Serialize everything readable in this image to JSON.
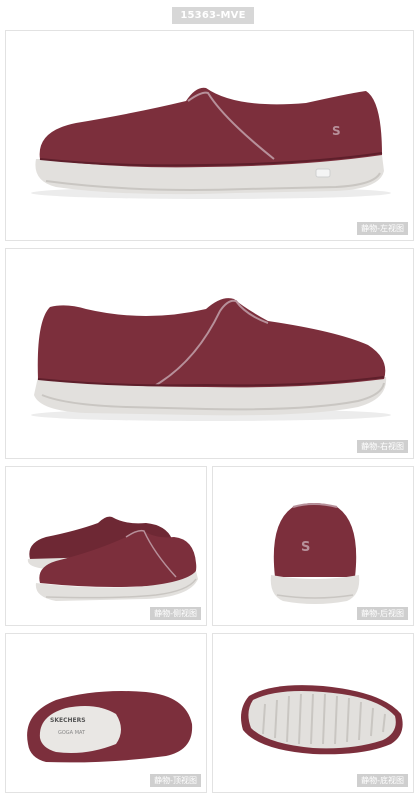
{
  "product": {
    "sku": "15363-MVE",
    "brand_text": "SKECHERS",
    "insole_text": "GOGA MAT",
    "colors": {
      "upper": "#7c2f3c",
      "upper_dark": "#5e1f2b",
      "trim": "#b7909a",
      "sole": "#e2e0dd",
      "sole_shadow": "#c9c6c2"
    }
  },
  "views": [
    {
      "label": "静物-左视图",
      "icon": "shoe-left-view"
    },
    {
      "label": "静物-右视图",
      "icon": "shoe-right-view"
    },
    {
      "label": "静物-侧视图",
      "icon": "shoe-side-pair-view"
    },
    {
      "label": "静物-后视图",
      "icon": "shoe-back-view"
    },
    {
      "label": "静物-顶视图",
      "icon": "shoe-top-view"
    },
    {
      "label": "静物-底视图",
      "icon": "shoe-bottom-view"
    }
  ]
}
